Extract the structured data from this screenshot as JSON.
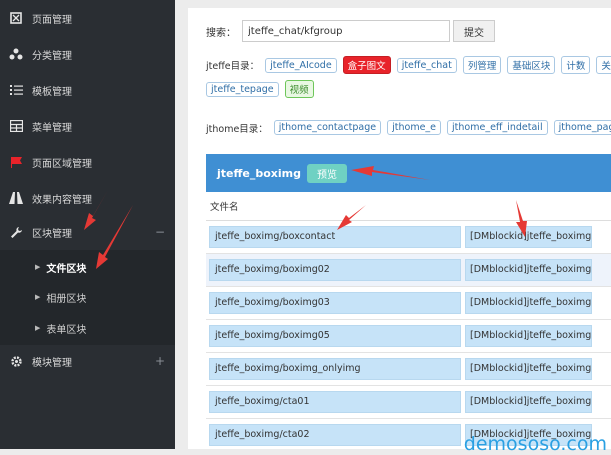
{
  "sidebar": {
    "items": [
      {
        "label": "页面管理",
        "icon": "page-icon"
      },
      {
        "label": "分类管理",
        "icon": "sitemap-icon"
      },
      {
        "label": "模板管理",
        "icon": "list-icon"
      },
      {
        "label": "菜单管理",
        "icon": "table-icon"
      },
      {
        "label": "页面区域管理",
        "icon": "flag-icon"
      },
      {
        "label": "效果内容管理",
        "icon": "road-icon"
      },
      {
        "label": "区块管理",
        "icon": "wrench-icon",
        "toggle": "−"
      },
      {
        "label": "模块管理",
        "icon": "gear-icon",
        "toggle": "+"
      }
    ],
    "sub_items": [
      {
        "label": "文件区块",
        "active": true
      },
      {
        "label": "相册区块",
        "active": false
      },
      {
        "label": "表单区块",
        "active": false
      }
    ]
  },
  "search": {
    "label": "搜索：",
    "value": "jteffe_chat/kfgroup",
    "button": "提交"
  },
  "jteffe_dir": {
    "label": "jteffe目录：",
    "tags_row1": [
      "jteffe_AIcode",
      "盒子图文",
      "jteffe_chat",
      "列管理",
      "基础区块",
      "计数",
      "关"
    ],
    "tags_row2": [
      "jteffe_tepage",
      "视频"
    ]
  },
  "jthome_dir": {
    "label": "jthome目录：",
    "tags": [
      "jthome_contactpage",
      "jthome_e",
      "jthome_eff_indetail",
      "jthome_pagelay"
    ]
  },
  "panel": {
    "title": "jteffe_boximg",
    "preview": "预览",
    "file_header": "文件名"
  },
  "files": [
    {
      "name": "jteffe_boximg/boxcontact",
      "code": "[DMblockid]jteffe_boximg/bo"
    },
    {
      "name": "jteffe_boximg/boximg02",
      "code": "[DMblockid]jteffe_boximg/bo"
    },
    {
      "name": "jteffe_boximg/boximg03",
      "code": "[DMblockid]jteffe_boximg/bo"
    },
    {
      "name": "jteffe_boximg/boximg05",
      "code": "[DMblockid]jteffe_boximg/bo"
    },
    {
      "name": "jteffe_boximg/boximg_onlyimg",
      "code": "[DMblockid]jteffe_boximg/bo"
    },
    {
      "name": "jteffe_boximg/cta01",
      "code": "[DMblockid]jteffe_boximg/ct"
    },
    {
      "name": "jteffe_boximg/cta02",
      "code": "[DMblockid]jteffe_boximg/ct"
    }
  ],
  "watermark": "demososo.com",
  "colors": {
    "sidebar_bg": "#2a2e33",
    "panel_header": "#3f8fd3",
    "cell_bg": "#c6e3f8",
    "arrow": "#e53935",
    "red_tag": "#e8232a"
  }
}
